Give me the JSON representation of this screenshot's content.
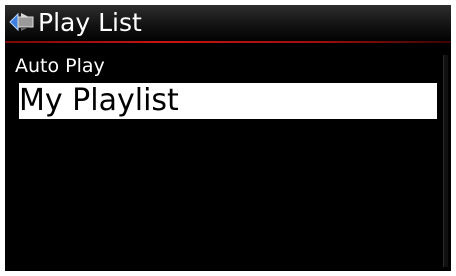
{
  "window": {
    "title": "Play List",
    "icon": "play-list-back-icon"
  },
  "menu": {
    "items": [
      {
        "label": "Auto Play",
        "selected": false
      },
      {
        "label": "My Playlist",
        "selected": true
      }
    ]
  },
  "colors": {
    "background": "#000000",
    "title_rule": "#c81414",
    "highlight_bg": "#ffffff",
    "highlight_text": "#000000",
    "text": "#ffffff"
  }
}
